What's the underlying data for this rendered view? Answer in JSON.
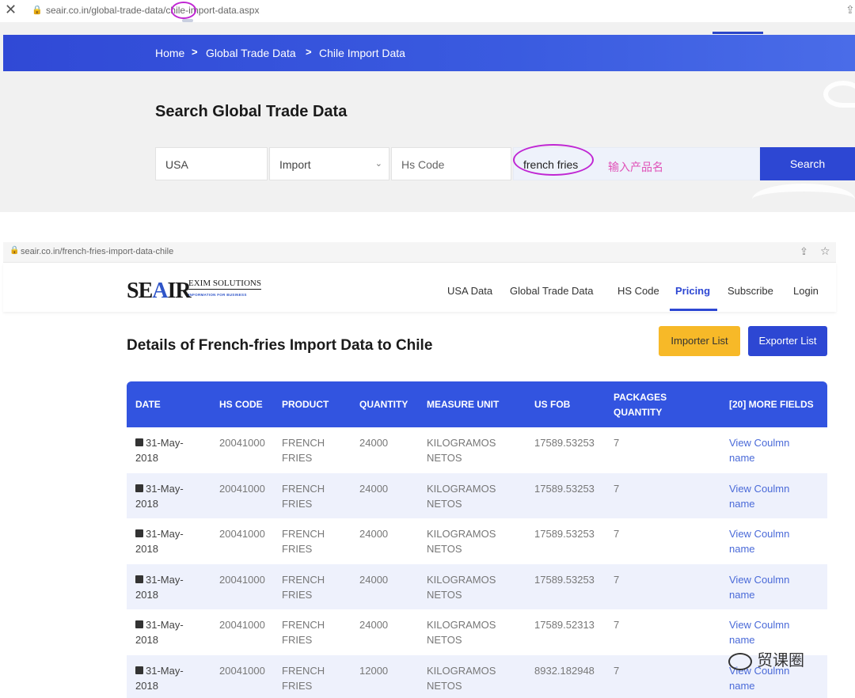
{
  "top": {
    "url": "seair.co.in/global-trade-data/chile-import-data.aspx",
    "breadcrumb": [
      "Home",
      "Global Trade Data",
      "Chile Import Data"
    ],
    "breadcrumb_sep": ">",
    "search_title": "Search Global Trade Data",
    "country_value": "USA",
    "type_value": "Import",
    "hs_placeholder": "Hs Code",
    "product_value": "french fries",
    "annotation": "输入产品名",
    "search_button": "Search"
  },
  "bottom": {
    "url": "seair.co.in/french-fries-import-data-chile",
    "logo": {
      "part1": "SE",
      "accent": "A",
      "part2": "IR",
      "sub1": "EXIM SOLUTIONS",
      "sub2": "INFORMATION FOR BUSINESS"
    },
    "nav": [
      "USA Data",
      "Global Trade Data",
      "HS Code",
      "Pricing",
      "Subscribe",
      "Login"
    ],
    "active_nav": "Pricing",
    "title": "Details of French-fries Import Data to Chile",
    "importer_button": "Importer List",
    "exporter_button": "Exporter List",
    "table": {
      "headers": [
        "DATE",
        "HS CODE",
        "PRODUCT",
        "QUANTITY",
        "MEASURE UNIT",
        "US FOB",
        "PACKAGES",
        "QUANTITY",
        "[20] MORE FIELDS"
      ],
      "rows": [
        {
          "date1": "31-May-",
          "date2": "2018",
          "hs": "20041000",
          "prod1": "FRENCH",
          "prod2": "FRIES",
          "qty": "24000",
          "unit1": "KILOGRAMOS",
          "unit2": "NETOS",
          "fob": "17589.53253",
          "pkg": "7",
          "link1": "View Coulmn",
          "link2": "name"
        },
        {
          "date1": "31-May-",
          "date2": "2018",
          "hs": "20041000",
          "prod1": "FRENCH",
          "prod2": "FRIES",
          "qty": "24000",
          "unit1": "KILOGRAMOS",
          "unit2": "NETOS",
          "fob": "17589.53253",
          "pkg": "7",
          "link1": "View Coulmn",
          "link2": "name"
        },
        {
          "date1": "31-May-",
          "date2": "2018",
          "hs": "20041000",
          "prod1": "FRENCH",
          "prod2": "FRIES",
          "qty": "24000",
          "unit1": "KILOGRAMOS",
          "unit2": "NETOS",
          "fob": "17589.53253",
          "pkg": "7",
          "link1": "View Coulmn",
          "link2": "name"
        },
        {
          "date1": "31-May-",
          "date2": "2018",
          "hs": "20041000",
          "prod1": "FRENCH",
          "prod2": "FRIES",
          "qty": "24000",
          "unit1": "KILOGRAMOS",
          "unit2": "NETOS",
          "fob": "17589.53253",
          "pkg": "7",
          "link1": "View Coulmn",
          "link2": "name"
        },
        {
          "date1": "31-May-",
          "date2": "2018",
          "hs": "20041000",
          "prod1": "FRENCH",
          "prod2": "FRIES",
          "qty": "24000",
          "unit1": "KILOGRAMOS",
          "unit2": "NETOS",
          "fob": "17589.52313",
          "pkg": "7",
          "link1": "View Coulmn",
          "link2": "name"
        },
        {
          "date1": "31-May-",
          "date2": "2018",
          "hs": "20041000",
          "prod1": "FRENCH",
          "prod2": "FRIES",
          "qty": "12000",
          "unit1": "KILOGRAMOS",
          "unit2": "NETOS",
          "fob": "8932.182948",
          "pkg": "7",
          "link1": "View Coulmn",
          "link2": "name"
        }
      ]
    }
  },
  "watermark": "贸课圈",
  "icons": {
    "close": "close-icon",
    "lock": "lock-icon",
    "share": "share-icon",
    "star": "star-icon",
    "calendar": "calendar-icon",
    "chevron": "chevron-down-icon"
  },
  "colors": {
    "brand_blue": "#2d47d3",
    "header_blue": "#3254e0",
    "importer_yellow": "#f7b928",
    "annotation_magenta": "#c026d3"
  }
}
